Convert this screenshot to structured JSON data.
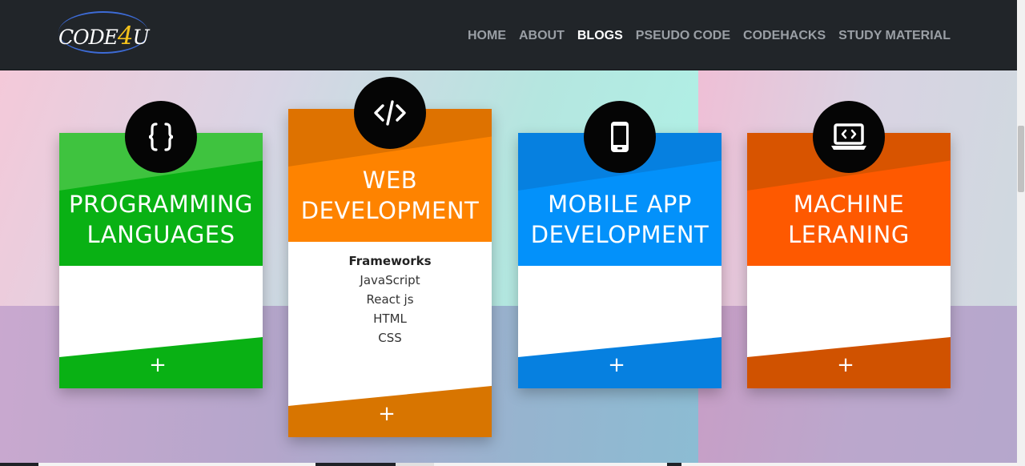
{
  "logo": {
    "prefix": "CODE",
    "number": "4",
    "suffix": "U"
  },
  "nav": {
    "items": [
      {
        "label": "HOME",
        "active": false
      },
      {
        "label": "ABOUT",
        "active": false
      },
      {
        "label": "BLOGS",
        "active": true
      },
      {
        "label": "PSEUDO CODE",
        "active": false
      },
      {
        "label": "CODEHACKS",
        "active": false
      },
      {
        "label": "STUDY MATERIAL",
        "active": false
      }
    ]
  },
  "cards": [
    {
      "title_line1": "PROGRAMMING",
      "title_line2": "LANGUAGES",
      "icon": "curly-braces-icon",
      "color": "#09b114",
      "color_light": "#3fc33f",
      "color_bottom": "#09b114",
      "plus": "+"
    },
    {
      "title_line1": "WEB",
      "title_line2": "DEVELOPMENT",
      "icon": "code-tag-icon",
      "color": "#fe8300",
      "color_light": "#de7200",
      "color_bottom": "#d87500",
      "body_heading": "Frameworks",
      "body_items": [
        "JavaScript",
        "React js",
        "HTML",
        "CSS"
      ],
      "plus": "+"
    },
    {
      "title_line1": "MOBILE APP",
      "title_line2": "DEVELOPMENT",
      "icon": "smartphone-icon",
      "color": "#0391fa",
      "color_light": "#0680e0",
      "color_bottom": "#0680e0",
      "plus": "+"
    },
    {
      "title_line1": "MACHINE",
      "title_line2": "LERANING",
      "icon": "laptop-code-icon",
      "color": "#fe5900",
      "color_light": "#d85400",
      "color_bottom": "#d05200",
      "plus": "+"
    }
  ]
}
